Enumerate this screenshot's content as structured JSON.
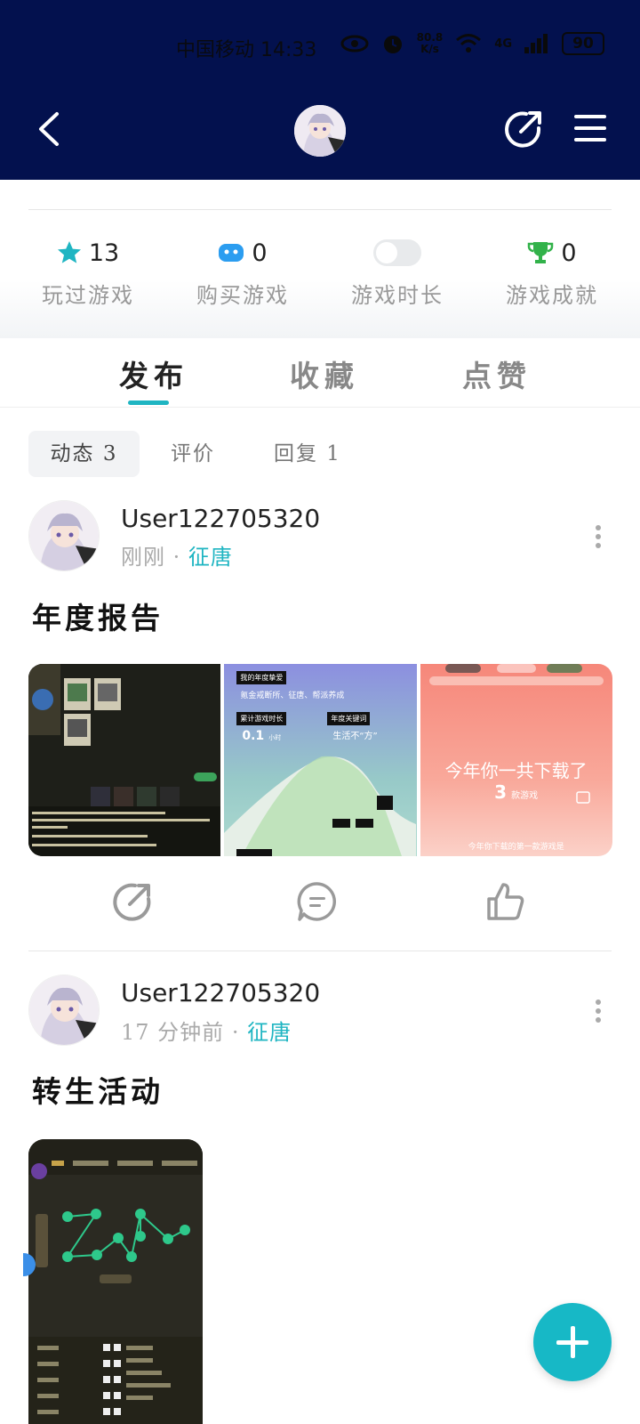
{
  "status_bar": {
    "carrier_time": "中国移动 14:33",
    "speed": "80.8",
    "speed_unit": "K/s",
    "network": "4G",
    "battery": "90"
  },
  "stats": [
    {
      "value": "13",
      "label": "玩过游戏",
      "icon": "star-icon",
      "color": "#1fb5c2"
    },
    {
      "value": "0",
      "label": "购买游戏",
      "icon": "gamepad-icon",
      "color": "#2b9df0"
    },
    {
      "value": "",
      "label": "游戏时长",
      "icon": "toggle-icon",
      "color": "#e8e8e8"
    },
    {
      "value": "0",
      "label": "游戏成就",
      "icon": "trophy-icon",
      "color": "#32b24a"
    }
  ],
  "tabs": [
    "发布",
    "收藏",
    "点赞"
  ],
  "subtabs": [
    "动态 3",
    "评价",
    "回复 1"
  ],
  "posts": [
    {
      "user": "User122705320",
      "time": "刚刚",
      "dot": "·",
      "game": "征唐",
      "title": "年度报告",
      "images": {
        "img2_line1": "我的年度挚爱",
        "img2_line2": "氪金戒断所、征唐、帮派养成",
        "img2_label1": "累计游戏时长",
        "img2_value1": "0.1",
        "img2_unit1": "小时",
        "img2_label2": "年度关键词",
        "img2_value2": "生活不“方”",
        "img3_line1": "今年你一共下载了",
        "img3_count": "3",
        "img3_unit": "款游戏",
        "img3_bottom": "今年你下载的第一款游戏是"
      }
    },
    {
      "user": "User122705320",
      "time": "17 分钟前",
      "dot": "·",
      "game": "征唐",
      "title": "转生活动"
    }
  ],
  "accent": "#1fb5c2",
  "header_bg": "#03114e"
}
